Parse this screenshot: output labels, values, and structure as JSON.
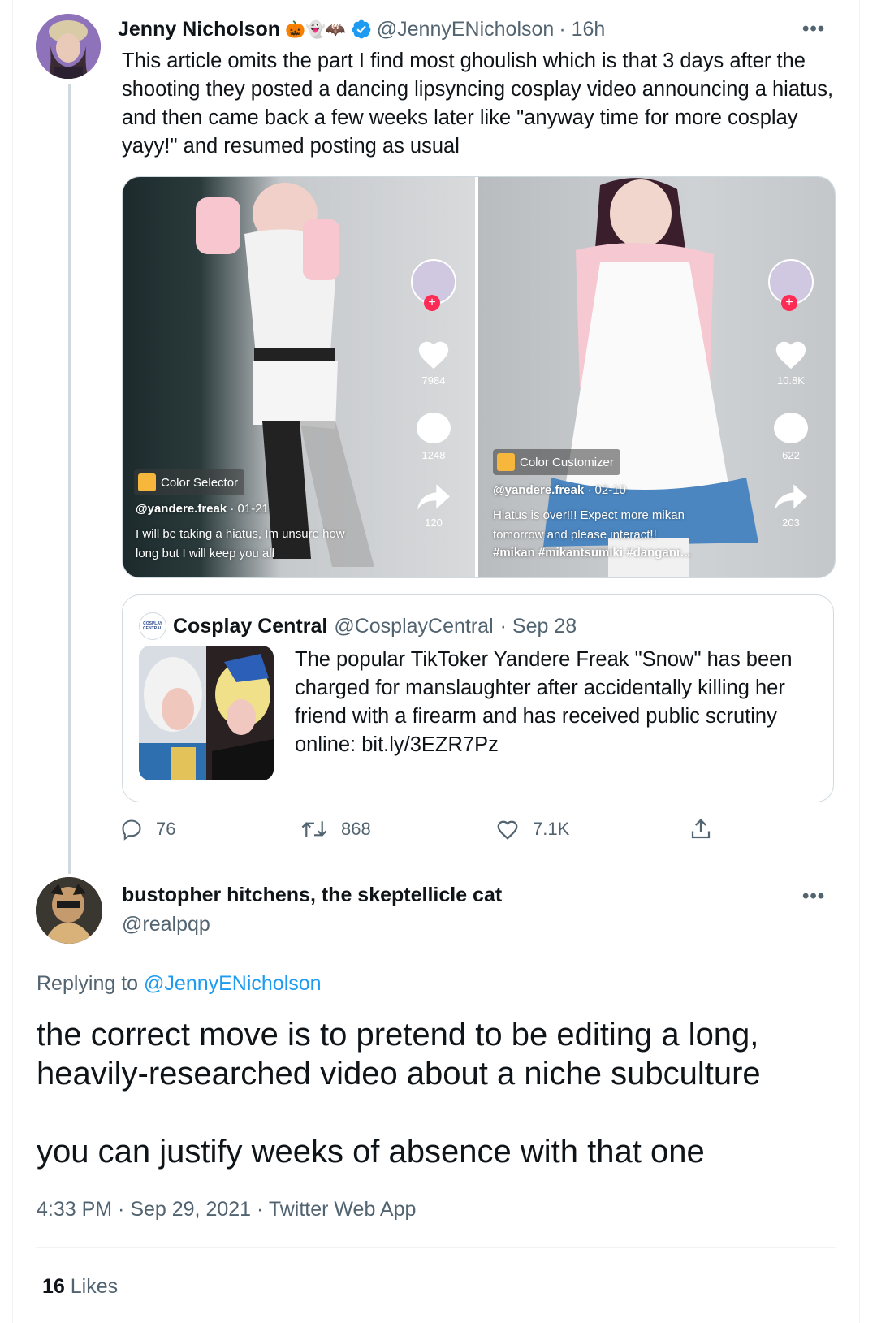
{
  "original_tweet": {
    "author_name": "Jenny Nicholson",
    "author_emojis": "🎃👻🦇",
    "verified": true,
    "handle": "@JennyENicholson",
    "time": "· 16h",
    "text": "This article omits the part I find most ghoulish which is that 3 days after the shooting they posted a dancing lipsyncing cosplay video announcing a hiatus, and then came back a few weeks later like \"anyway time for more cosplay yayy!\" and resumed posting as usual",
    "more_label": "•••",
    "media": {
      "left": {
        "likes": "7984",
        "comments": "1248",
        "shares": "120",
        "effect": "Color Selector",
        "user": "@yandere.freak",
        "date": "· 01-21",
        "caption": "I will be taking a hiatus, Im unsure how long but I will keep you all"
      },
      "right": {
        "likes": "10.8K",
        "comments": "622",
        "shares": "203",
        "effect": "Color Customizer",
        "user": "@yandere.freak",
        "date": "· 02-10",
        "caption": "Hiatus is over!!! Expect more mikan tomorrow and please interact!!",
        "tags": "#mikan #mikantsumiki #danganr..."
      }
    },
    "quote": {
      "logo_text": "COSPLAY CENTRAL",
      "name": "Cosplay Central",
      "handle": "@CosplayCentral",
      "date": "· Sep 28",
      "text": "The popular TikToker Yandere Freak \"Snow\" has been charged for manslaughter after accidentally killing her friend with a firearm and has received public scrutiny online: bit.ly/3EZR7Pz"
    },
    "actions": {
      "replies": "76",
      "retweets": "868",
      "likes": "7.1K"
    }
  },
  "reply_tweet": {
    "author_name": "bustopher hitchens, the skeptellicle cat",
    "handle": "@realpqp",
    "more_label": "•••",
    "replying_to_label": "Replying to",
    "replying_to_handle": "@JennyENicholson",
    "text_line1": "the correct move is to pretend to be editing a long, heavily-researched video about a niche subculture",
    "text_line2": "you can justify weeks of absence with that one",
    "timestamp": "4:33 PM · Sep 29, 2021 · Twitter Web App",
    "likes_count": "16",
    "likes_label": "Likes"
  },
  "colors": {
    "accent": "#1d9bf0",
    "muted": "#536471",
    "border": "#cfd9de"
  }
}
